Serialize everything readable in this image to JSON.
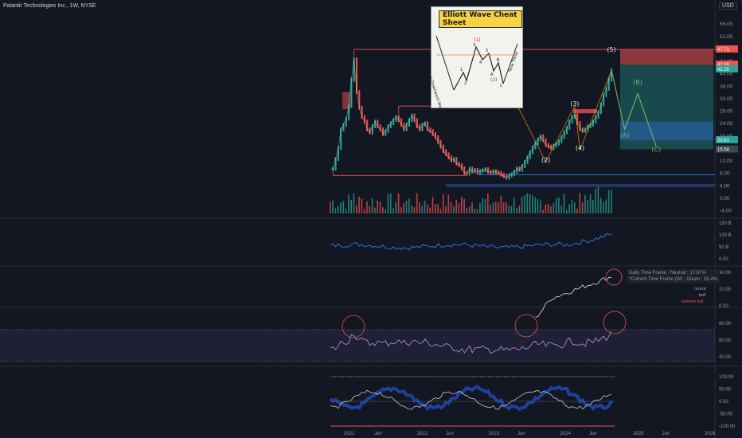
{
  "header": {
    "title": "Palantir Technologies Inc., 1W, NYSE",
    "currency": "USD"
  },
  "cheat_sheet": {
    "title": "Elliott Wave Cheat Sheet",
    "left_label": "Last Downward Wave",
    "right_label": "New Trend",
    "points": [
      "1",
      "2",
      "3",
      "4",
      "5",
      "A",
      "B",
      "C"
    ],
    "marks": [
      "(1)",
      "(2)"
    ]
  },
  "indicator_info": {
    "line1": "Daily Time Frame : Neutral : 17.67%",
    "line2": "*Current Time Frame (W) : Green : 35.4%",
    "legend": [
      "neutral",
      "bull",
      "extreme bull"
    ]
  },
  "colors": {
    "background": "#131722",
    "up": "#26a69a",
    "down": "#ef5350",
    "blue": "#3179f5",
    "purple": "#b39ddb",
    "wave": "#66bb6a",
    "orange": "#ff9800"
  },
  "chart_data": [
    {
      "type": "line",
      "name": "price",
      "x_ticks": [
        "2021",
        "Jun",
        "2022",
        "Jun",
        "2023",
        "Jun",
        "2024",
        "Jun",
        "2025",
        "Jun",
        "2026"
      ],
      "y_ticks": [
        -4,
        0,
        4,
        8,
        12,
        16,
        20,
        24,
        28,
        32,
        36,
        40,
        44,
        48,
        52,
        56
      ],
      "ylim": [
        -5,
        60
      ],
      "price_labels": [
        "47.71",
        "42.80",
        "42.35",
        "20.61",
        "15.58"
      ],
      "series": [
        {
          "values": [
            [
              0,
              9.2
            ],
            [
              1,
              9.4
            ],
            [
              2,
              12.5
            ],
            [
              3,
              16
            ],
            [
              4,
              22
            ],
            [
              5,
              23.5
            ],
            [
              6,
              25.5
            ],
            [
              7,
              29.5
            ],
            [
              8,
              38
            ],
            [
              9,
              44.5
            ],
            [
              10,
              34
            ],
            [
              11,
              29
            ],
            [
              12,
              26
            ],
            [
              13,
              24.5
            ],
            [
              14,
              22
            ],
            [
              15,
              21
            ],
            [
              16,
              23
            ],
            [
              17,
              24.5
            ],
            [
              18,
              23
            ],
            [
              19,
              22
            ],
            [
              20,
              20.5
            ],
            [
              21,
              21.5
            ],
            [
              22,
              23
            ],
            [
              23,
              24
            ],
            [
              24,
              25
            ],
            [
              25,
              26
            ],
            [
              26,
              25
            ],
            [
              27,
              23.5
            ],
            [
              28,
              22
            ],
            [
              29,
              23.5
            ],
            [
              30,
              25
            ],
            [
              31,
              26.5
            ],
            [
              32,
              25
            ],
            [
              33,
              23
            ],
            [
              34,
              22
            ],
            [
              35,
              23.5
            ],
            [
              36,
              24
            ],
            [
              37,
              22
            ],
            [
              38,
              21.5
            ],
            [
              39,
              20.5
            ],
            [
              40,
              19.5
            ],
            [
              41,
              18
            ],
            [
              42,
              16.5
            ],
            [
              43,
              15
            ],
            [
              44,
              14
            ],
            [
              45,
              13
            ],
            [
              46,
              12
            ],
            [
              47,
              12.5
            ],
            [
              48,
              11
            ],
            [
              49,
              10.5
            ],
            [
              50,
              9.5
            ],
            [
              51,
              8
            ],
            [
              52,
              7.8
            ],
            [
              53,
              9.4
            ],
            [
              54,
              8.5
            ],
            [
              55,
              9
            ],
            [
              56,
              8.2
            ],
            [
              57,
              8.6
            ],
            [
              58,
              8.9
            ],
            [
              59,
              9.2
            ],
            [
              60,
              8.4
            ],
            [
              61,
              8.1
            ],
            [
              62,
              8.6
            ],
            [
              63,
              8.2
            ],
            [
              64,
              8
            ],
            [
              65,
              7.4
            ],
            [
              66,
              7
            ],
            [
              67,
              6.5
            ],
            [
              68,
              7.2
            ],
            [
              69,
              7.6
            ],
            [
              70,
              8.4
            ],
            [
              71,
              9.5
            ],
            [
              72,
              9
            ],
            [
              73,
              10.2
            ],
            [
              74,
              11.5
            ],
            [
              75,
              13
            ],
            [
              76,
              14.6
            ],
            [
              77,
              16.2
            ],
            [
              78,
              17.5
            ],
            [
              79,
              18.8
            ],
            [
              80,
              19.8
            ],
            [
              81,
              18.5
            ],
            [
              82,
              17
            ],
            [
              83,
              16.5
            ],
            [
              84,
              16
            ],
            [
              85,
              16.8
            ],
            [
              86,
              17.4
            ],
            [
              87,
              18.2
            ],
            [
              88,
              19.5
            ],
            [
              89,
              21
            ],
            [
              90,
              22.5
            ],
            [
              91,
              24.5
            ],
            [
              92,
              26
            ],
            [
              93,
              26.5
            ],
            [
              94,
              24
            ],
            [
              95,
              22
            ],
            [
              96,
              21.5
            ],
            [
              97,
              22
            ],
            [
              98,
              23
            ],
            [
              99,
              23.5
            ],
            [
              100,
              24.5
            ],
            [
              101,
              26
            ],
            [
              102,
              27.5
            ],
            [
              103,
              30
            ],
            [
              104,
              33
            ],
            [
              105,
              35
            ],
            [
              106,
              38
            ],
            [
              107,
              41
            ]
          ]
        }
      ],
      "annotations": [
        {
          "x": 65,
          "y": 40,
          "text": "(1)"
        },
        {
          "x": 82,
          "y": 11.5,
          "text": "(2)"
        },
        {
          "x": 93,
          "y": 29.5,
          "text": "(3)"
        },
        {
          "x": 95,
          "y": 15.4,
          "text": "(4)"
        },
        {
          "x": 107,
          "y": 47,
          "text": "(5)"
        },
        {
          "x": 112,
          "y": 19.5,
          "text": "(A)"
        },
        {
          "x": 117,
          "y": 36.5,
          "text": "(B)"
        },
        {
          "x": 124,
          "y": 14.8,
          "text": "(C)"
        }
      ],
      "projection": [
        [
          107,
          41
        ],
        [
          112,
          22
        ],
        [
          117,
          33.5
        ],
        [
          124,
          16.5
        ]
      ]
    },
    {
      "type": "line",
      "name": "indicator-1",
      "y_ticks": [
        "150 B",
        "100 B",
        "50 B",
        "0"
      ]
    },
    {
      "type": "line",
      "name": "indicator-2",
      "y_ticks": [
        40,
        20,
        0
      ]
    },
    {
      "type": "line",
      "name": "indicator-3",
      "y_ticks": [
        80,
        60,
        40
      ]
    },
    {
      "type": "line",
      "name": "indicator-4",
      "y_ticks": [
        100,
        50,
        0,
        -50,
        -100
      ]
    }
  ]
}
